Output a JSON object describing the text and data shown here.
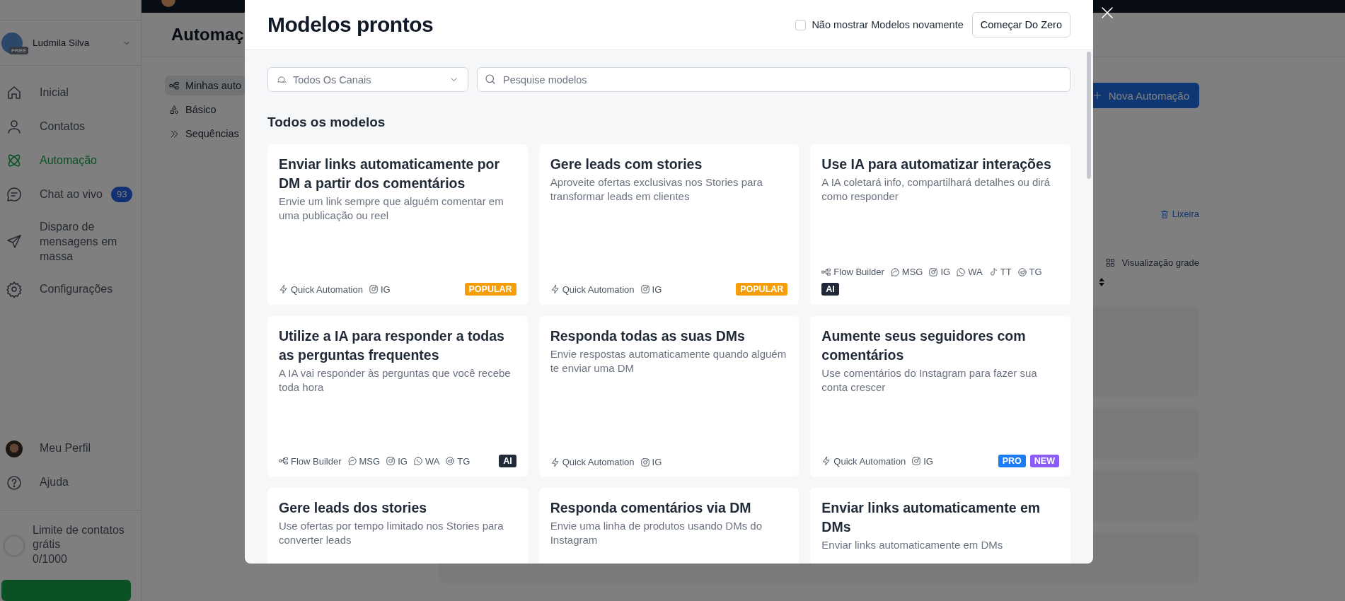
{
  "sidebar": {
    "user": {
      "name": "Ludmila Silva",
      "plan": "FREE"
    },
    "nav": [
      {
        "label": "Inicial",
        "selected": false
      },
      {
        "label": "Contatos",
        "selected": false
      },
      {
        "label": "Automação",
        "selected": true
      },
      {
        "label": "Chat ao vivo",
        "selected": false,
        "badge": "93"
      },
      {
        "label": "Disparo de mensagens em massa",
        "selected": false
      },
      {
        "label": "Configurações",
        "selected": false
      }
    ],
    "bottom_nav": [
      {
        "label": "Meu Perfil"
      },
      {
        "label": "Ajuda"
      }
    ],
    "limit": {
      "label": "Limite de contatos grátis",
      "value": "0/1000"
    }
  },
  "page": {
    "title": "Automaç",
    "subnav": [
      {
        "label": "Minhas auto",
        "selected": true
      },
      {
        "label": "Básico",
        "selected": false
      },
      {
        "label": "Sequências",
        "selected": false
      }
    ],
    "new_button": "Nova Automação",
    "trash_link": "Lixeira",
    "view_toggle": "Visualização grade"
  },
  "modal": {
    "title": "Modelos prontos",
    "dont_show": {
      "label": "Não mostrar Modelos novamente",
      "checked": false
    },
    "start_button": "Começar Do Zero",
    "channel_filter": "Todos Os Canais",
    "search": {
      "placeholder": "Pesquise modelos"
    },
    "section_title": "Todos os modelos",
    "templates": [
      {
        "title": "Enviar links automaticamente por DM a partir dos comentários",
        "description": "Envie um link sempre que alguém comentar em uma publicação ou reel",
        "tags": [
          {
            "label": "Quick Automation",
            "kind": "quick"
          },
          {
            "label": "IG",
            "kind": "ig"
          }
        ],
        "badges": [
          {
            "label": "POPULAR",
            "kind": "popular"
          }
        ]
      },
      {
        "title": "Gere leads com stories",
        "description": "Aproveite ofertas exclusivas nos Stories para transformar leads em clientes",
        "tags": [
          {
            "label": "Quick Automation",
            "kind": "quick"
          },
          {
            "label": "IG",
            "kind": "ig"
          }
        ],
        "badges": [
          {
            "label": "POPULAR",
            "kind": "popular"
          }
        ]
      },
      {
        "title": "Use IA para automatizar interações",
        "description": "A IA coletará info, compartilhará detalhes ou dirá como responder",
        "tags": [
          {
            "label": "Flow Builder",
            "kind": "flow"
          },
          {
            "label": "MSG",
            "kind": "msg"
          },
          {
            "label": "IG",
            "kind": "ig"
          },
          {
            "label": "WA",
            "kind": "wa"
          },
          {
            "label": "TT",
            "kind": "tt"
          },
          {
            "label": "TG",
            "kind": "tg"
          }
        ],
        "badges": [
          {
            "label": "AI",
            "kind": "ai"
          }
        ]
      },
      {
        "title": "Utilize a IA para responder a todas as perguntas frequentes",
        "description": "A IA vai responder às perguntas que você recebe toda hora",
        "tags": [
          {
            "label": "Flow Builder",
            "kind": "flow"
          },
          {
            "label": "MSG",
            "kind": "msg"
          },
          {
            "label": "IG",
            "kind": "ig"
          },
          {
            "label": "WA",
            "kind": "wa"
          },
          {
            "label": "TG",
            "kind": "tg"
          }
        ],
        "badges": [
          {
            "label": "AI",
            "kind": "ai"
          }
        ]
      },
      {
        "title": "Responda todas as suas DMs",
        "description": "Envie respostas automaticamente quando alguém te enviar uma DM",
        "tags": [
          {
            "label": "Quick Automation",
            "kind": "quick"
          },
          {
            "label": "IG",
            "kind": "ig"
          }
        ]
      },
      {
        "title": "Aumente seus seguidores com comentários",
        "description": "Use comentários do Instagram para fazer sua conta crescer",
        "tags": [
          {
            "label": "Quick Automation",
            "kind": "quick"
          },
          {
            "label": "IG",
            "kind": "ig"
          }
        ],
        "badges": [
          {
            "label": "PRO",
            "kind": "pro"
          },
          {
            "label": "NEW",
            "kind": "new"
          }
        ]
      },
      {
        "title": "Gere leads dos stories",
        "description": "Use ofertas por tempo limitado nos Stories para converter leads"
      },
      {
        "title": "Responda comentários via DM",
        "description": "Envie uma linha de produtos usando DMs do Instagram"
      },
      {
        "title": "Enviar links automaticamente em DMs",
        "description": "Enviar links automaticamente em DMs"
      }
    ]
  }
}
